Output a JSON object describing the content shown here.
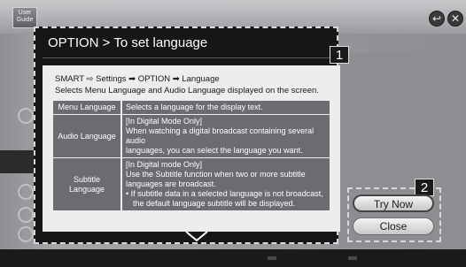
{
  "app": {
    "logo_line1": "User",
    "logo_line2": "Guide"
  },
  "top_controls": {
    "back_icon": "back-arrow-icon",
    "close_icon": "close-x-icon",
    "back_glyph": "↩",
    "close_glyph": "✕"
  },
  "dialog": {
    "title": "OPTION > To set language",
    "path": "SMART ⇨ Settings ➡ OPTION ➡ Language",
    "description": "Selects Menu Language and Audio Language displayed on the screen.",
    "rows": [
      {
        "label": "Menu Language",
        "lines": [
          "Selects a language for the display text."
        ]
      },
      {
        "label": "Audio Language",
        "lines": [
          "[In Digital Mode Only]",
          "When watching a digital broadcast containing several audio",
          "languages, you can select the language you want."
        ]
      },
      {
        "label": "Subtitle Language",
        "lines": [
          "[In Digital mode Only]",
          "Use the Subtitle function when two or more subtitle",
          "languages are broadcast.",
          "• If subtitle data in a selected language is not broadcast,",
          "the default language subtitle will be displayed."
        ]
      }
    ],
    "scroll_icon": "chevron-down-icon"
  },
  "markers": {
    "badge1": "1",
    "badge2": "2"
  },
  "buttons": {
    "try_now": "Try Now",
    "close": "Close"
  }
}
